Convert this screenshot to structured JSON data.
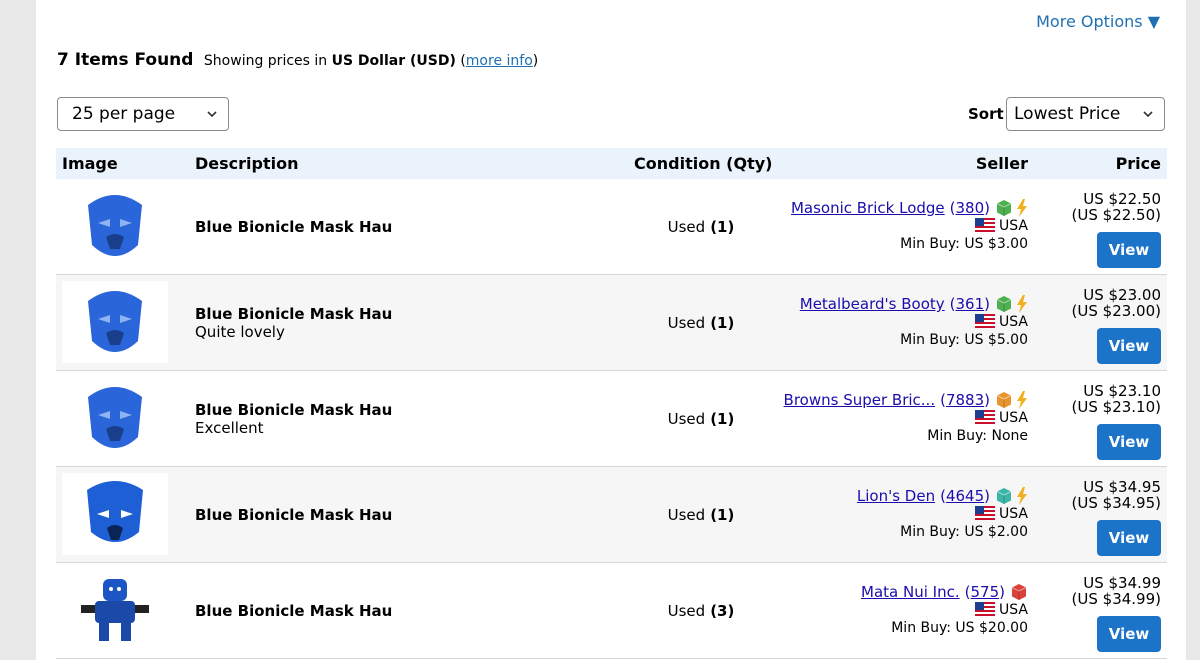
{
  "more_options": "More Options ▼",
  "header": {
    "count_text": "7 Items Found",
    "showing_text": "Showing prices in",
    "currency": "US Dollar (USD)",
    "more_info": "more info"
  },
  "per_page": {
    "selected": "25 per page"
  },
  "sort": {
    "label": "Sort",
    "selected": "Lowest Price"
  },
  "columns": {
    "image": "Image",
    "description": "Description",
    "condition": "Condition (Qty)",
    "seller": "Seller",
    "price": "Price"
  },
  "rows": [
    {
      "title": "Blue Bionicle Mask Hau",
      "note": "",
      "condition": "Used",
      "qty": "(1)",
      "seller": "Masonic Brick Lodge",
      "feedback": "380",
      "country": "USA",
      "min_buy": "Min Buy: US $3.00",
      "price": "US $22.50",
      "price_conv": "(US $22.50)",
      "view": "View",
      "box_color": "#4caf50",
      "bolt": true
    },
    {
      "title": "Blue Bionicle Mask Hau",
      "note": "Quite lovely",
      "condition": "Used",
      "qty": "(1)",
      "seller": "Metalbeard's Booty",
      "feedback": "361",
      "country": "USA",
      "min_buy": "Min Buy: US $5.00",
      "price": "US $23.00",
      "price_conv": "(US $23.00)",
      "view": "View",
      "box_color": "#4caf50",
      "bolt": true
    },
    {
      "title": "Blue Bionicle Mask Hau",
      "note": "Excellent",
      "condition": "Used",
      "qty": "(1)",
      "seller": "Browns Super Bric...",
      "feedback": "7883",
      "country": "USA",
      "min_buy": "Min Buy: None",
      "price": "US $23.10",
      "price_conv": "(US $23.10)",
      "view": "View",
      "box_color": "#e8952e",
      "bolt": true
    },
    {
      "title": "Blue Bionicle Mask Hau",
      "note": "",
      "condition": "Used",
      "qty": "(1)",
      "seller": "Lion's Den",
      "feedback": "4645",
      "country": "USA",
      "min_buy": "Min Buy: US $2.00",
      "price": "US $34.95",
      "price_conv": "(US $34.95)",
      "view": "View",
      "box_color": "#3bb5a8",
      "bolt": true
    },
    {
      "title": "Blue Bionicle Mask Hau",
      "note": "",
      "condition": "Used",
      "qty": "(3)",
      "seller": "Mata Nui Inc.",
      "feedback": "575",
      "country": "USA",
      "min_buy": "Min Buy: US $20.00",
      "price": "US $34.99",
      "price_conv": "(US $34.99)",
      "view": "View",
      "box_color": "#d9413b",
      "bolt": false
    }
  ]
}
